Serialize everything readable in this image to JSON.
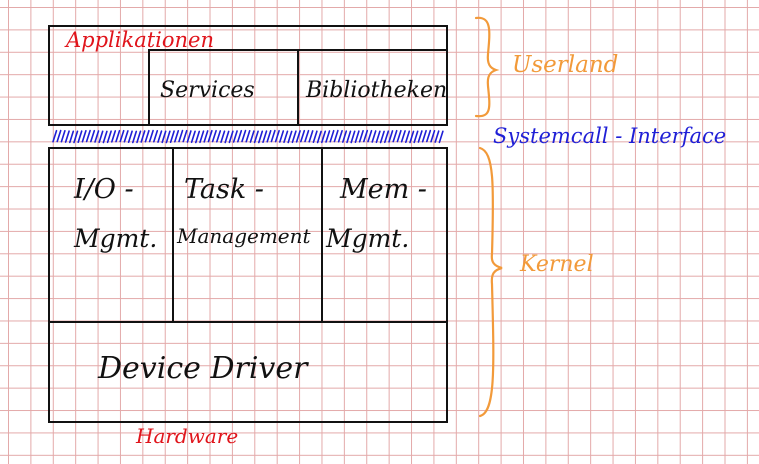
{
  "userland_block": {
    "applications": "Applikationen",
    "services": "Services",
    "libraries": "Bibliotheken"
  },
  "kernel_block": {
    "io_line1": "I/O -",
    "io_line2": "Mgmt.",
    "task_line1": "Task -",
    "task_line2": "Management",
    "mem_line1": "Mem -",
    "mem_line2": "Mgmt.",
    "device_driver": "Device Driver"
  },
  "hardware": "Hardware",
  "annotations": {
    "userland": "Userland",
    "syscall_interface": "Systemcall - Interface",
    "kernel": "Kernel"
  },
  "colors": {
    "ink": "#111111",
    "red": "#e0141b",
    "orange": "#f29a3a",
    "blue": "#1f1fd6",
    "grid": "#e3a9a9"
  }
}
